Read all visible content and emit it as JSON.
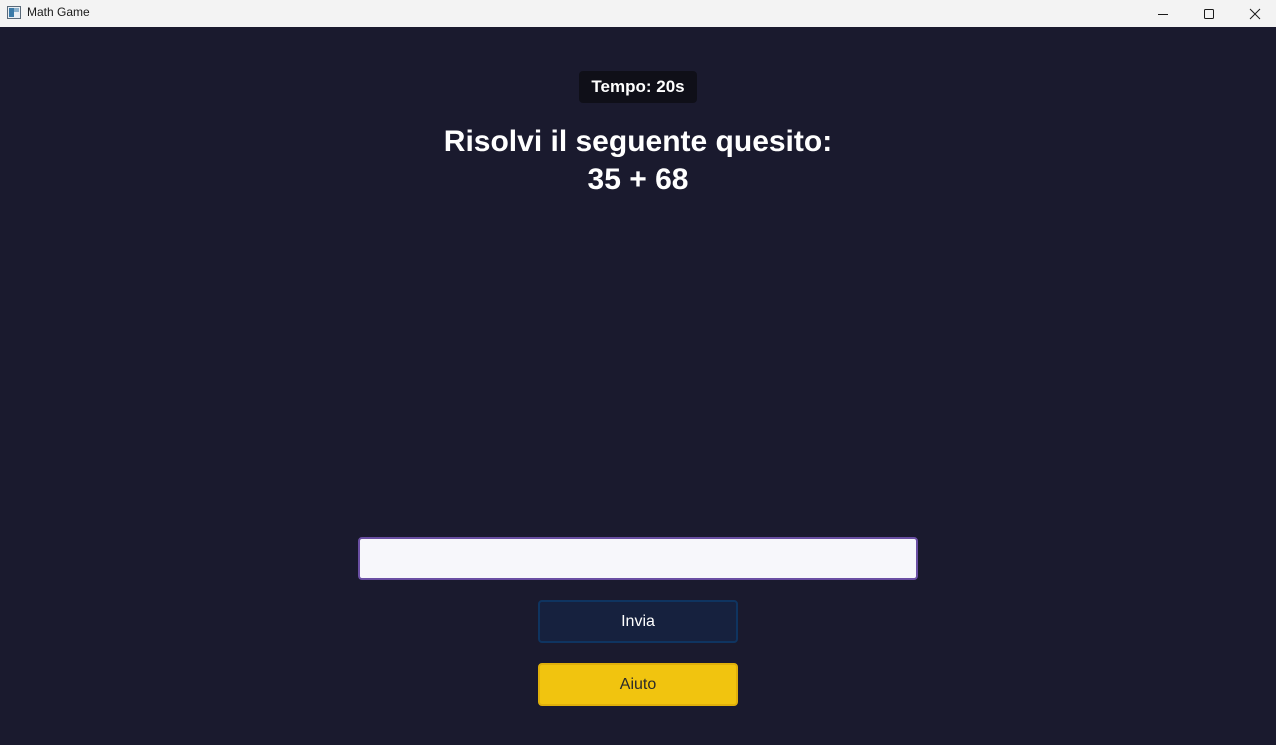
{
  "window": {
    "title": "Math Game",
    "icons": {
      "app": "app-window-icon",
      "minimize": "minimize-icon",
      "maximize": "maximize-icon",
      "close": "close-icon"
    }
  },
  "game": {
    "timer": "Tempo: 20s",
    "prompt": "Risolvi il seguente quesito:",
    "expression": "35 + 68",
    "answer": {
      "value": "",
      "placeholder": ""
    },
    "submit_label": "Invia",
    "help_label": "Aiuto"
  },
  "colors": {
    "background": "#1a1a2e",
    "timer_bg": "#0f0f18",
    "input_border": "#6a4fa3",
    "submit_bg": "#16213e",
    "submit_border": "#0f3460",
    "help_bg": "#f1c40f"
  }
}
